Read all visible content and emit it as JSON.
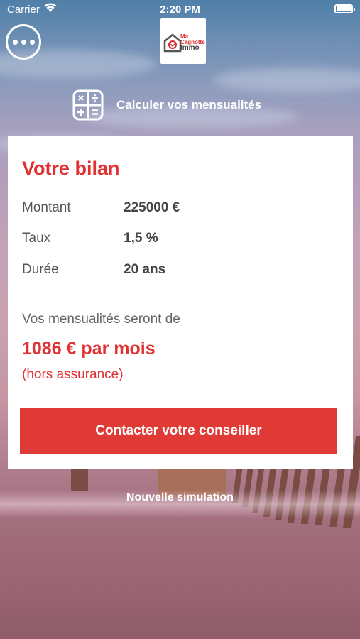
{
  "status_bar": {
    "carrier": "Carrier",
    "time": "2:20 PM"
  },
  "header": {
    "menu_icon": "more-dots-icon",
    "logo": {
      "line1": "Ma",
      "line2": "Cagnotte",
      "line3": "Immo"
    },
    "calc_icon": "calculator-icon",
    "calc_label": "Calculer vos mensualités"
  },
  "card": {
    "title": "Votre bilan",
    "rows": [
      {
        "label": "Montant",
        "value": "225000 €"
      },
      {
        "label": "Taux",
        "value": "1,5 %"
      },
      {
        "label": "Durée",
        "value": "20 ans"
      }
    ],
    "intro": "Vos mensualités seront de",
    "amount": "1086 € par mois",
    "note": "(hors assurance)",
    "cta_label": "Contacter votre conseiller"
  },
  "new_simulation_label": "Nouvelle simulation",
  "colors": {
    "accent": "#e03a36",
    "card_bg": "#ffffff",
    "text": "#555555"
  }
}
